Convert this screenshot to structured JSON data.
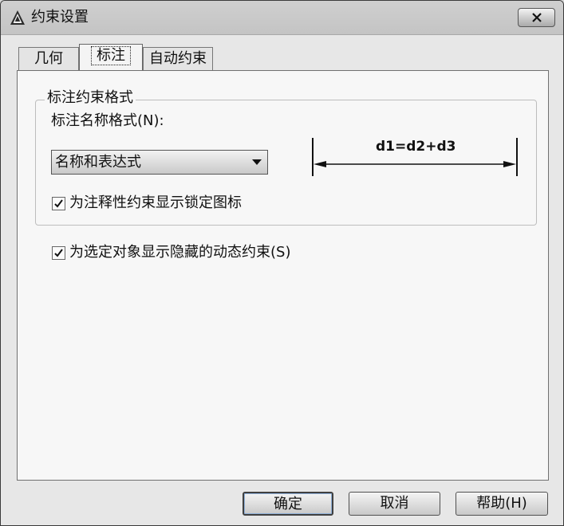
{
  "window": {
    "title": "约束设置"
  },
  "tabs": [
    {
      "label": "几何"
    },
    {
      "label": "标注"
    },
    {
      "label": "自动约束"
    }
  ],
  "dimension_format": {
    "group_title": "标注约束格式",
    "name_format_label": "标注名称格式(N):",
    "selected_format": "名称和表达式",
    "preview_expression": "d1=d2+d3",
    "show_lock_icon_label": "为注释性约束显示锁定图标",
    "show_lock_icon_checked": true
  },
  "general": {
    "show_hidden_label": "为选定对象显示隐藏的动态约束(S)",
    "show_hidden_checked": true
  },
  "buttons": {
    "ok": "确定",
    "cancel": "取消",
    "help": "帮助(H)"
  },
  "icons": {
    "app": "autocad-logo-icon",
    "close": "close-icon",
    "dropdown": "chevron-down-icon",
    "check": "check-icon"
  }
}
